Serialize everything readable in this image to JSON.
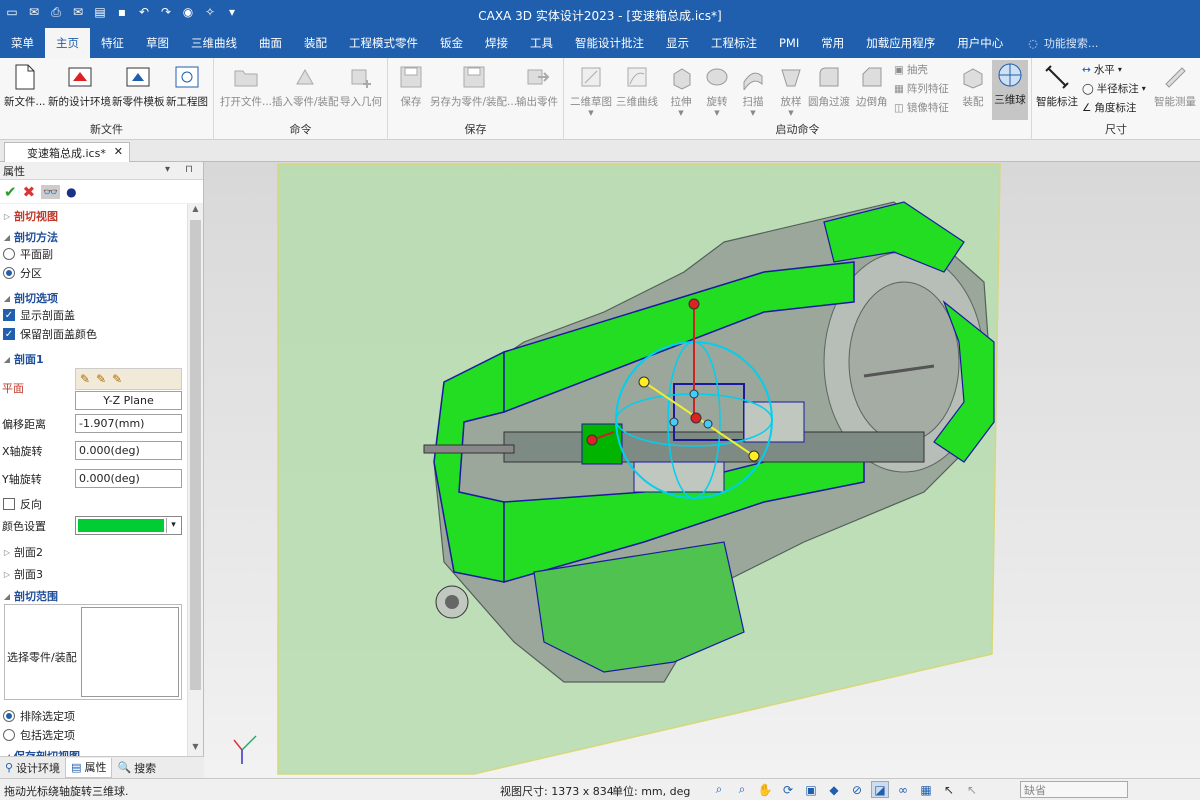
{
  "window": {
    "title": "CAXA 3D 实体设计2023 - [变速箱总成.ics*]"
  },
  "colors": {
    "titlebar": "#1f5fae",
    "section_plane": "#00cc33",
    "accent": "#1f5fae"
  },
  "quick_access": [
    "new-doc-icon",
    "mail-icon",
    "print-icon",
    "mail-open-icon",
    "folder-icon",
    "save-icon",
    "undo-icon",
    "redo-icon",
    "globe-icon",
    "sparkle-icon",
    "dropdown-icon"
  ],
  "menu": {
    "tabs": [
      "菜单",
      "主页",
      "特征",
      "草图",
      "三维曲线",
      "曲面",
      "装配",
      "工程模式零件",
      "钣金",
      "焊接",
      "工具",
      "智能设计批注",
      "显示",
      "工程标注",
      "PMI",
      "常用",
      "加载应用程序",
      "用户中心"
    ],
    "active_index": 1,
    "search_placeholder": "功能搜索..."
  },
  "ribbon": {
    "new_file": {
      "label": "新文件",
      "buttons": [
        "新文件...",
        "新的设计环境",
        "新零件模板",
        "新工程图"
      ]
    },
    "command": {
      "label": "命令",
      "buttons": [
        "打开文件...",
        "插入零件/装配",
        "导入几何"
      ]
    },
    "save": {
      "label": "保存",
      "buttons": [
        "保存",
        "另存为零件/装配...",
        "输出零件"
      ]
    },
    "launch": {
      "label": "启动命令",
      "buttons": [
        "二维草图",
        "三维曲线",
        "拉伸",
        "旋转",
        "扫描",
        "放样",
        "圆角过渡",
        "边倒角"
      ],
      "small": [
        "抽壳",
        "阵列特征",
        "镜像特征"
      ],
      "extra": [
        "装配",
        "三维球"
      ]
    },
    "dimension": {
      "label": "尺寸",
      "smart": "智能标注",
      "small": [
        "水平",
        "半径标注",
        "角度标注"
      ],
      "measure": "智能测量"
    }
  },
  "document": {
    "tab": "变速箱总成.ics*"
  },
  "panel": {
    "title": "属性",
    "sections": {
      "section_view": "剖切视图",
      "method": "剖切方法",
      "method_options": [
        "平面副",
        "分区"
      ],
      "method_selected": 1,
      "options": "剖切选项",
      "show_cap": "显示剖面盖",
      "keep_cap_color": "保留剖面盖颜色",
      "plane1": "剖面1",
      "plane_label": "平面",
      "plane_value": "Y-Z Plane",
      "offset_label": "偏移距离",
      "offset_value": "-1.907(mm)",
      "xrot_label": "X轴旋转",
      "xrot_value": "0.000(deg)",
      "yrot_label": "Y轴旋转",
      "yrot_value": "0.000(deg)",
      "reverse": "反向",
      "color_label": "颜色设置",
      "plane2": "剖面2",
      "plane3": "剖面3",
      "range": "剖切范围",
      "select_parts": "选择零件/装配",
      "exclude": "排除选定项",
      "include": "包括选定项",
      "save_view": "保存剖切视图"
    },
    "footer_tabs": [
      "设计环境",
      "属性",
      "搜索"
    ],
    "footer_active": 1
  },
  "status": {
    "message": "拖动光标绕轴旋转三维球.",
    "view_size_label": "视图尺寸:",
    "view_size": "1373 x 834",
    "unit_label": "单位:",
    "unit": "mm, deg",
    "dropdown": "缺省"
  }
}
